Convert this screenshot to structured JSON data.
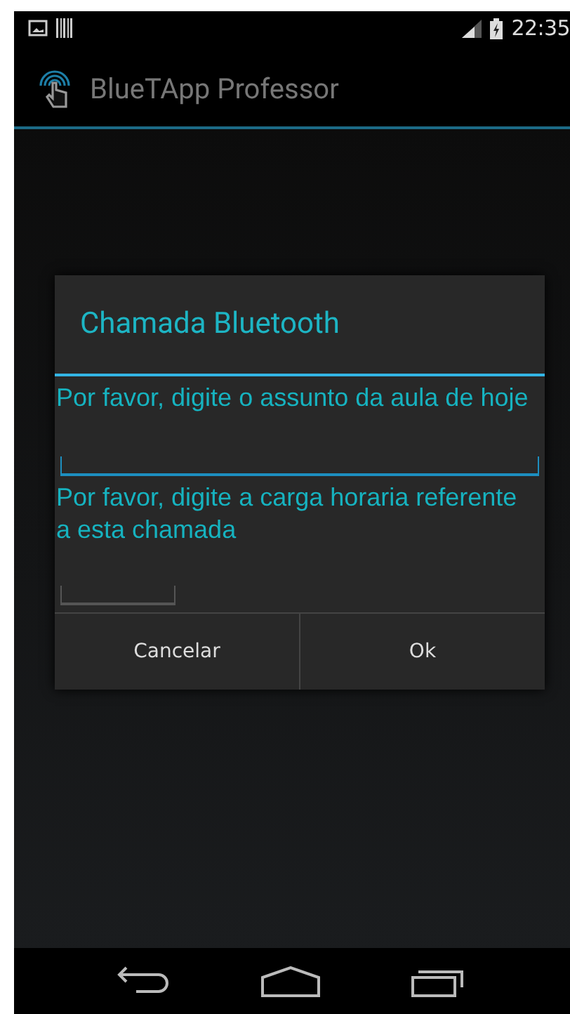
{
  "status_bar": {
    "time": "22:35"
  },
  "app_bar": {
    "title": "BlueTApp Professor"
  },
  "dialog": {
    "title": "Chamada Bluetooth",
    "fields": [
      {
        "label": "Por favor, digite o assunto da aula de hoje",
        "focused": true,
        "kind": "wide"
      },
      {
        "label": "Por favor, digite a carga horaria referente a esta chamada",
        "focused": false,
        "kind": "short"
      }
    ],
    "buttons": [
      "Cancelar",
      "Ok"
    ]
  }
}
